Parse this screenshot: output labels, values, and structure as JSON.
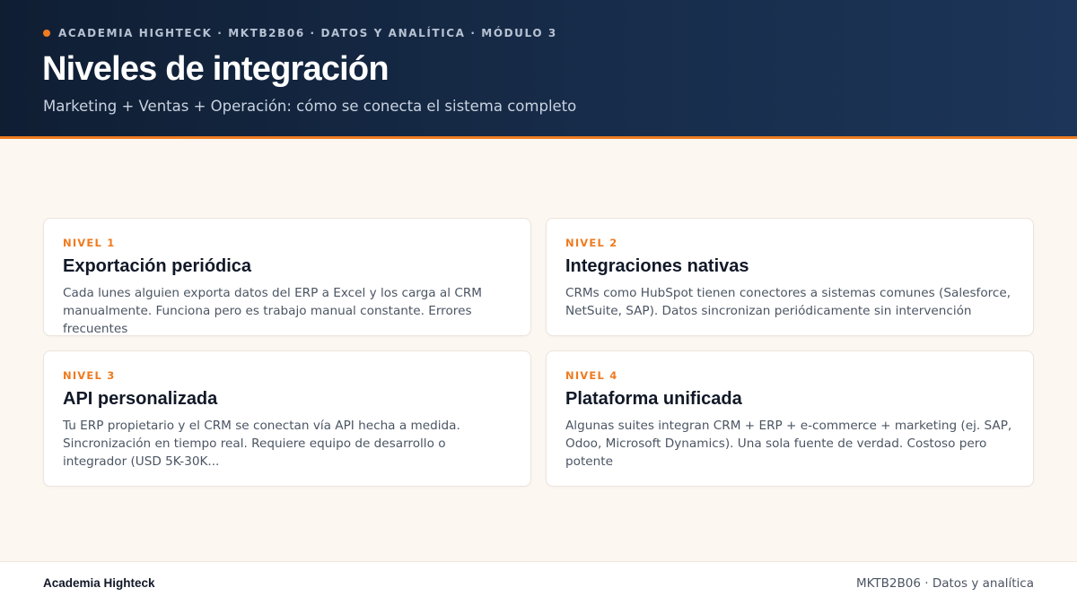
{
  "header": {
    "eyebrow": "ACADEMIA HIGHTECK · MKTB2B06 · DATOS Y ANALÍTICA · MÓDULO 3",
    "title": "Niveles de integración",
    "subtitle": "Marketing + Ventas + Operación: cómo se conecta el sistema completo"
  },
  "colors": {
    "accent": "#f07c20",
    "header_bg": "#132540",
    "page_bg": "#fdf7f2"
  },
  "cards": [
    {
      "level": "NIVEL 1",
      "title": "Exportación periódica",
      "description": "Cada lunes alguien exporta datos del ERP a Excel y los carga al CRM manualmente. Funciona pero es trabajo manual constante. Errores frecuentes"
    },
    {
      "level": "NIVEL 2",
      "title": "Integraciones nativas",
      "description": "CRMs como HubSpot tienen conectores a sistemas comunes (Salesforce, NetSuite, SAP). Datos sincronizan periódicamente sin intervención"
    },
    {
      "level": "NIVEL 3",
      "title": "API personalizada",
      "description": "Tu ERP propietario y el CRM se conectan vía API hecha a medida. Sincronización en tiempo real. Requiere equipo de desarrollo o integrador (USD 5K-30K..."
    },
    {
      "level": "NIVEL 4",
      "title": "Plataforma unificada",
      "description": "Algunas suites integran CRM + ERP + e-commerce + marketing (ej. SAP, Odoo, Microsoft Dynamics). Una sola fuente de verdad. Costoso pero potente"
    }
  ],
  "footer": {
    "left": "Academia Highteck",
    "right": "MKTB2B06 · Datos y analítica"
  }
}
